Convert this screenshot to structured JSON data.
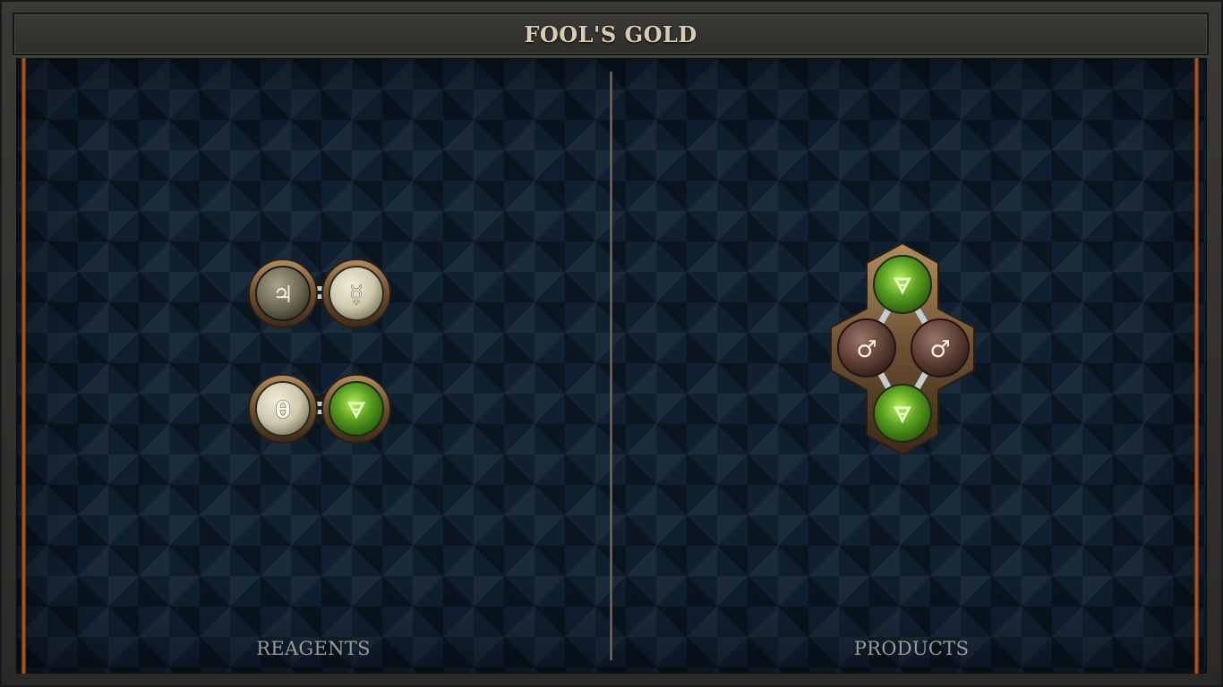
{
  "title": "FOOL'S GOLD",
  "panels": {
    "reagents": {
      "label": "REAGENTS",
      "molecules": [
        {
          "atoms": [
            {
              "element": "tin",
              "symbol": "♃"
            },
            {
              "element": "quicksilver",
              "symbol": "☿"
            }
          ]
        },
        {
          "atoms": [
            {
              "element": "salt",
              "symbol": "θ"
            },
            {
              "element": "earth",
              "symbol": "🜃"
            }
          ]
        }
      ]
    },
    "products": {
      "label": "PRODUCTS",
      "molecules": [
        {
          "atoms": [
            {
              "element": "earth",
              "symbol": "🜃"
            },
            {
              "element": "iron",
              "symbol": "♂"
            },
            {
              "element": "iron",
              "symbol": "♂"
            },
            {
              "element": "earth",
              "symbol": "🜃"
            }
          ]
        }
      ]
    }
  },
  "colors": {
    "pale_atom": "#d7d2bd",
    "tin_atom": "#7f7a63",
    "earth_atom": "#5aa021",
    "iron_atom": "#6e4a40",
    "bond": "#b7c2c8",
    "brass": "#8a6a45"
  }
}
